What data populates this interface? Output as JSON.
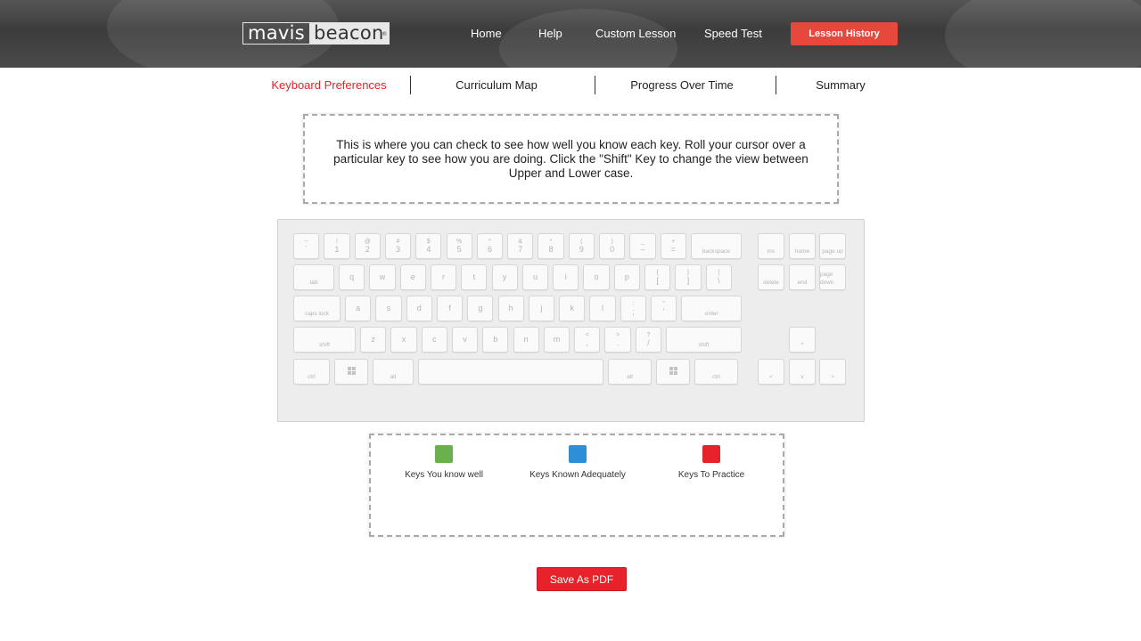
{
  "header": {
    "logo_part1": "mavis",
    "logo_part2": "beacon",
    "logo_mark": "®",
    "nav": [
      "Home",
      "Help",
      "Custom Lesson",
      "Speed Test"
    ],
    "lesson_history": "Lesson History"
  },
  "tabs": {
    "items": [
      "Keyboard Preferences",
      "Curriculum Map",
      "Progress Over Time",
      "Summary"
    ],
    "active": "Keyboard Preferences"
  },
  "description": "This is where you can check to see how well you know each key. Roll your cursor over a particular key to see how you are doing. Click the \"Shift\" Key to change the view between Upper and Lower case.",
  "keyboard": {
    "row1": [
      {
        "top": "~",
        "bottom": "`"
      },
      {
        "top": "!",
        "bottom": "1"
      },
      {
        "top": "@",
        "bottom": "2"
      },
      {
        "top": "#",
        "bottom": "3"
      },
      {
        "top": "$",
        "bottom": "4"
      },
      {
        "top": "%",
        "bottom": "5"
      },
      {
        "top": "^",
        "bottom": "6"
      },
      {
        "top": "&",
        "bottom": "7"
      },
      {
        "top": "*",
        "bottom": "8"
      },
      {
        "top": "(",
        "bottom": "9"
      },
      {
        "top": ")",
        "bottom": "0"
      },
      {
        "top": "_",
        "bottom": "–"
      },
      {
        "top": "+",
        "bottom": "="
      },
      {
        "word": "backspace"
      }
    ],
    "row2": [
      {
        "word": "tab"
      },
      {
        "single": "q"
      },
      {
        "single": "w"
      },
      {
        "single": "e"
      },
      {
        "single": "r"
      },
      {
        "single": "t"
      },
      {
        "single": "y"
      },
      {
        "single": "u"
      },
      {
        "single": "i"
      },
      {
        "single": "o"
      },
      {
        "single": "p"
      },
      {
        "top": "{",
        "bottom": "["
      },
      {
        "top": "}",
        "bottom": "]"
      },
      {
        "top": "|",
        "bottom": "\\"
      }
    ],
    "row3": [
      {
        "word": "caps lock"
      },
      {
        "single": "a"
      },
      {
        "single": "s"
      },
      {
        "single": "d"
      },
      {
        "single": "f"
      },
      {
        "single": "g"
      },
      {
        "single": "h"
      },
      {
        "single": "j"
      },
      {
        "single": "k"
      },
      {
        "single": "l"
      },
      {
        "top": ":",
        "bottom": ";"
      },
      {
        "top": "\"",
        "bottom": "'"
      },
      {
        "word": "enter"
      }
    ],
    "row4": [
      {
        "word": "shift"
      },
      {
        "single": "z"
      },
      {
        "single": "x"
      },
      {
        "single": "c"
      },
      {
        "single": "v"
      },
      {
        "single": "b"
      },
      {
        "single": "n"
      },
      {
        "single": "m"
      },
      {
        "top": "<",
        "bottom": ","
      },
      {
        "top": ">",
        "bottom": "."
      },
      {
        "top": "?",
        "bottom": "/"
      },
      {
        "word": "shift"
      }
    ],
    "row5": [
      {
        "word": "ctrl"
      },
      {
        "icon": "windows-icon"
      },
      {
        "word": "alt"
      },
      {
        "word": ""
      },
      {
        "word": "alt"
      },
      {
        "icon": "windows-icon"
      },
      {
        "word": "ctrl"
      }
    ],
    "nav_cluster": [
      {
        "word": "ins"
      },
      {
        "word": "home"
      },
      {
        "word": "page up"
      },
      {
        "word": "delete"
      },
      {
        "word": "end"
      },
      {
        "word": "page down"
      },
      {
        "word": "^"
      },
      {
        "word": "<"
      },
      {
        "word": "v"
      },
      {
        "word": ">"
      }
    ]
  },
  "legend": [
    {
      "label": "Keys You know well",
      "color": "#6ab04c"
    },
    {
      "label": "Keys Known Adequately",
      "color": "#2e8fd8"
    },
    {
      "label": "Keys To Practice",
      "color": "#e8222a"
    }
  ],
  "save_pdf": "Save As PDF"
}
